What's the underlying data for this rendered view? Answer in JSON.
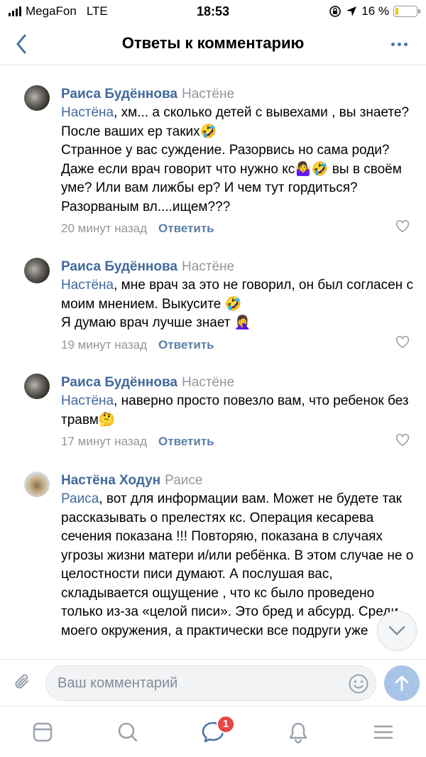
{
  "status_bar": {
    "carrier": "MegaFon",
    "network": "LTE",
    "time": "18:53",
    "battery_percent_text": "16 %",
    "battery_level": 0.16,
    "icons": [
      "signal-icon",
      "orientation-lock-icon",
      "location-icon",
      "battery-icon"
    ]
  },
  "nav": {
    "title": "Ответы к комментарию",
    "back_icon": "chevron-left-icon",
    "more_icon": "more-dots-icon"
  },
  "comments": [
    {
      "author": "Раиса Будённова",
      "reply_to": "Настёне",
      "mention": "Настёна",
      "text": ", хм... а сколько детей с вывехами , вы знаете? После ваших ер таких🤣\nСтранное у вас суждение.  Разорвись но сама роди? Даже если врач говорит что нужно кс🤷‍♀️🤣 вы в своём уме? Или вам лижбы ер? И чем тут гордиться? Разорваным вл....ищем???",
      "time": "20 минут назад",
      "reply_label": "Ответить"
    },
    {
      "author": "Раиса Будённова",
      "reply_to": "Настёне",
      "mention": "Настёна",
      "text": ", мне врач за это не говорил, он был согласен с моим мнением. Выкусите 🤣\nЯ думаю врач лучше знает 🤦‍♀️",
      "time": "19 минут назад",
      "reply_label": "Ответить"
    },
    {
      "author": "Раиса Будённова",
      "reply_to": "Настёне",
      "mention": "Настёна",
      "text": ", наверно просто повезло вам, что ребенок без травм🤔",
      "time": "17 минут назад",
      "reply_label": "Ответить"
    },
    {
      "author": "Настёна Ходун",
      "reply_to": "Раисе",
      "mention": "Раиса",
      "text": ", вот для информации вам. Может не будете так рассказывать о прелестях кс. Операция кесарева сечения показана !!! Повторяю, показана в случаях угрозы жизни матери и/или ребёнка. В этом случае не о целостности писи думают. А послушая вас, складывается ощущение , что кс было проведено только из-за «целой писи». Это бред и абсурд. Среди моего окружения, а практически все подруги уже",
      "time": "",
      "reply_label": ""
    }
  ],
  "composer": {
    "placeholder": "Ваш комментарий",
    "attach_icon": "paperclip-icon",
    "emoji_icon": "smiley-icon",
    "send_icon": "send-arrow-icon"
  },
  "tab_bar": {
    "items": [
      "news-icon",
      "search-icon",
      "messages-icon",
      "notifications-icon",
      "menu-icon"
    ],
    "messages_badge": "1"
  },
  "colors": {
    "accent": "#41699c",
    "secondary_text": "#939699",
    "badge": "#e64646",
    "send_button": "#a8c4e6"
  }
}
